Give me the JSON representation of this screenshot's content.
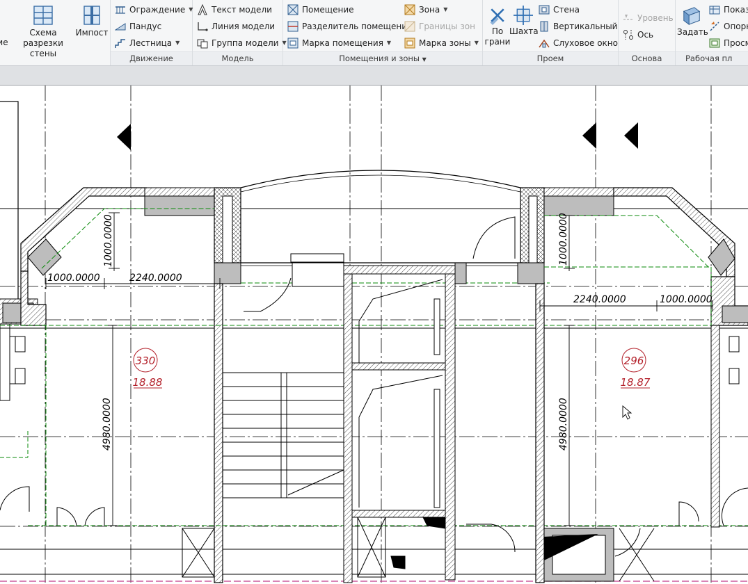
{
  "ribbon": {
    "left_partial": {
      "label_line1": "",
      "label_line2": "ие"
    },
    "section_schema": {
      "line1": "Схема разрезки",
      "line2": "стены"
    },
    "impost": {
      "label": "Импост"
    },
    "movement": {
      "title": "Движение",
      "items": [
        {
          "label": "Ограждение",
          "has_dropdown": true,
          "icon": "railing-icon"
        },
        {
          "label": "Пандус",
          "has_dropdown": false,
          "icon": "ramp-icon"
        },
        {
          "label": "Лестница",
          "has_dropdown": true,
          "icon": "stair-icon"
        }
      ]
    },
    "model": {
      "title": "Модель",
      "items": [
        {
          "label": "Текст модели",
          "icon": "model-text-icon"
        },
        {
          "label": "Линия  модели",
          "icon": "model-line-icon"
        },
        {
          "label": "Группа модели",
          "has_dropdown": true,
          "icon": "model-group-icon"
        }
      ]
    },
    "rooms": {
      "title": "Помещения и зоны",
      "left": [
        {
          "label": "Помещение",
          "icon": "room-icon"
        },
        {
          "label": "Разделитель помещений",
          "icon": "room-separator-icon"
        },
        {
          "label": "Марка помещения",
          "has_dropdown": true,
          "icon": "room-tag-icon"
        }
      ],
      "right": [
        {
          "label": "Зона",
          "has_dropdown": true,
          "icon": "area-icon",
          "disabled": false
        },
        {
          "label": "Границы зон",
          "icon": "area-boundary-icon",
          "disabled": true
        },
        {
          "label": "Марка зоны",
          "has_dropdown": true,
          "icon": "area-tag-icon",
          "disabled": false
        }
      ]
    },
    "opening": {
      "title": "Проем",
      "by_face": {
        "line1": "По",
        "line2": "грани"
      },
      "shaft": {
        "label": "Шахта"
      },
      "items": [
        {
          "label": "Стена",
          "icon": "wall-opening-icon"
        },
        {
          "label": "Вертикальный",
          "icon": "vertical-opening-icon"
        },
        {
          "label": "Слуховое окно",
          "icon": "dormer-icon"
        }
      ]
    },
    "datum": {
      "title": "Основа",
      "items": [
        {
          "label": "Уровень",
          "icon": "level-icon",
          "disabled": true
        },
        {
          "label": "Ось",
          "icon": "grid-icon",
          "disabled": false
        }
      ]
    },
    "workplane": {
      "title": "Рабочая пл",
      "set": {
        "label": "Задать"
      },
      "items": [
        {
          "label": "Показ",
          "icon": "show-icon"
        },
        {
          "label": "Опорн",
          "icon": "ref-plane-icon"
        },
        {
          "label": "Просм",
          "icon": "viewer-icon"
        }
      ]
    }
  },
  "drawing": {
    "dimensions": {
      "left_top_short": "1000.0000",
      "left_vertical_short": "1000.0000",
      "left_width": "2240.0000",
      "left_height": "4980.0000",
      "right_width": "2240.0000",
      "right_top_short": "1000.0000",
      "right_vertical_short": "1000.0000",
      "right_height": "4980.0000"
    },
    "rooms": [
      {
        "number": "330",
        "area": "18.88"
      },
      {
        "number": "296",
        "area": "18.87"
      }
    ],
    "colors": {
      "room_tag": "#b3202a",
      "room_boundary": "#0a8a0a",
      "wall_cut": "#000000",
      "fill_gray": "#bdbdbd"
    }
  }
}
